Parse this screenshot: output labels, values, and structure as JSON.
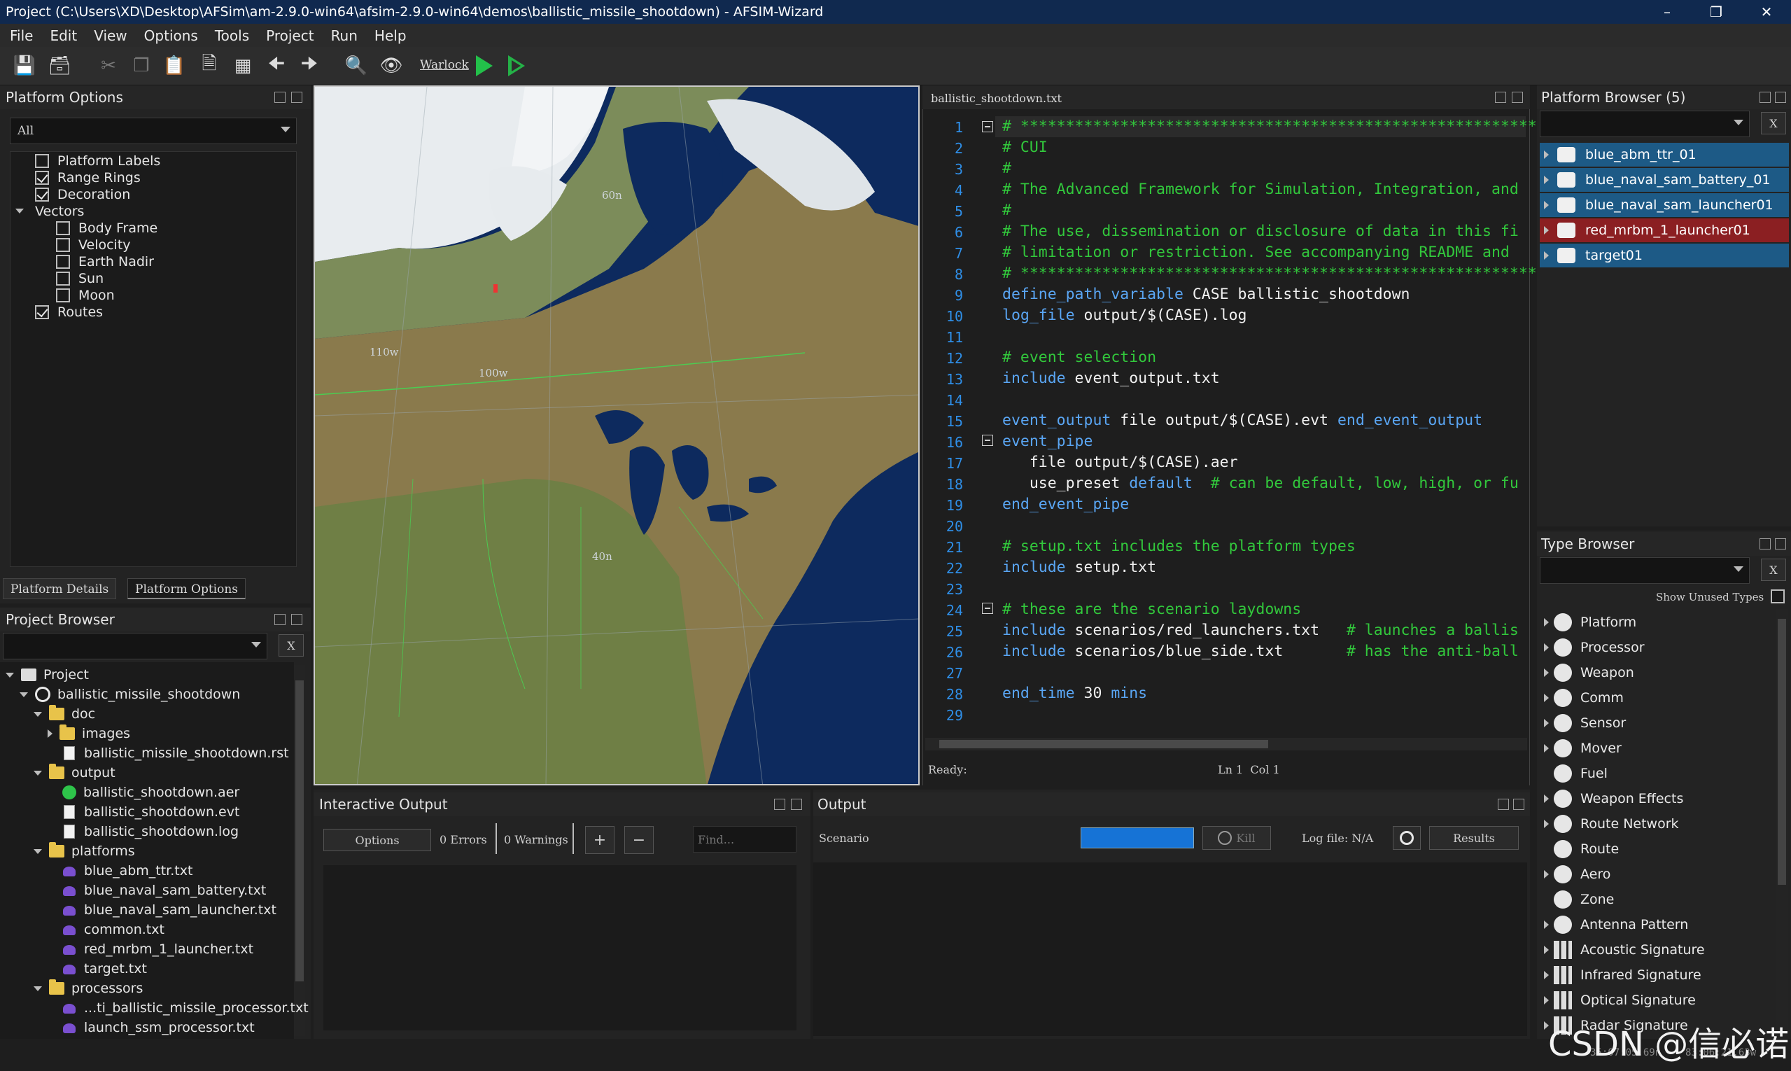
{
  "window": {
    "title": "Project (C:\\Users\\XD\\Desktop\\AFSim\\am-2.9.0-win64\\afsim-2.9.0-win64\\demos\\ballistic_missile_shootdown) - AFSIM-Wizard"
  },
  "menu": [
    "File",
    "Edit",
    "View",
    "Options",
    "Tools",
    "Project",
    "Run",
    "Help"
  ],
  "toolbar": {
    "warlock_label": "Warlock"
  },
  "platform_options": {
    "title": "Platform Options",
    "filter_value": "All",
    "items": [
      {
        "label": "Platform Labels",
        "checked": false
      },
      {
        "label": "Range Rings",
        "checked": true
      },
      {
        "label": "Decoration",
        "checked": true
      },
      {
        "label": "Vectors",
        "group": true
      },
      {
        "label": "Body Frame",
        "checked": false
      },
      {
        "label": "Velocity",
        "checked": false
      },
      {
        "label": "Earth Nadir",
        "checked": false
      },
      {
        "label": "Sun",
        "checked": false
      },
      {
        "label": "Moon",
        "checked": false
      },
      {
        "label": "Routes",
        "checked": true
      }
    ],
    "tabs": [
      "Platform Details",
      "Platform Options"
    ]
  },
  "project_browser": {
    "title": "Project Browser",
    "clear_label": "X",
    "tree": [
      "Project",
      "ballistic_missile_shootdown",
      "doc",
      "images",
      "ballistic_missile_shootdown.rst",
      "output",
      "ballistic_shootdown.aer",
      "ballistic_shootdown.evt",
      "ballistic_shootdown.log",
      "platforms",
      "blue_abm_ttr.txt",
      "blue_naval_sam_battery.txt",
      "blue_naval_sam_launcher.txt",
      "common.txt",
      "red_mrbm_1_launcher.txt",
      "target.txt",
      "processors",
      "...ti_ballistic_missile_processor.txt",
      "launch_ssm_processor.txt"
    ]
  },
  "map": {
    "labels": [
      "60n",
      "110w",
      "100w",
      "40n"
    ]
  },
  "editor": {
    "filename": "ballistic_shootdown.txt",
    "lines": [
      {
        "n": "1",
        "parts": [
          [
            "cm",
            "# ***************************************************************"
          ]
        ]
      },
      {
        "n": "2",
        "parts": [
          [
            "cm",
            "# CUI"
          ]
        ]
      },
      {
        "n": "3",
        "parts": [
          [
            "cm",
            "#"
          ]
        ]
      },
      {
        "n": "4",
        "parts": [
          [
            "cm",
            "# The Advanced Framework for Simulation, Integration, and"
          ]
        ]
      },
      {
        "n": "5",
        "parts": [
          [
            "cm",
            "#"
          ]
        ]
      },
      {
        "n": "6",
        "parts": [
          [
            "cm",
            "# The use, dissemination or disclosure of data in this fi"
          ]
        ]
      },
      {
        "n": "7",
        "parts": [
          [
            "cm",
            "# limitation or restriction. See accompanying README and"
          ]
        ]
      },
      {
        "n": "8",
        "parts": [
          [
            "cm",
            "# ***************************************************************"
          ]
        ]
      },
      {
        "n": "9",
        "parts": [
          [
            "kw",
            "define_path_variable"
          ],
          [
            "tx",
            " CASE ballistic_shootdown"
          ]
        ]
      },
      {
        "n": "10",
        "parts": [
          [
            "kw",
            "log_file"
          ],
          [
            "tx",
            " output/$(CASE).log"
          ]
        ]
      },
      {
        "n": "11",
        "parts": []
      },
      {
        "n": "12",
        "parts": [
          [
            "cm",
            "# event selection"
          ]
        ]
      },
      {
        "n": "13",
        "parts": [
          [
            "kw",
            "include"
          ],
          [
            "tx",
            " event_output.txt"
          ]
        ]
      },
      {
        "n": "14",
        "parts": []
      },
      {
        "n": "15",
        "parts": [
          [
            "kw",
            "event_output"
          ],
          [
            "tx",
            " file output/$(CASE).evt "
          ],
          [
            "kw",
            "end_event_output"
          ]
        ]
      },
      {
        "n": "16",
        "parts": [
          [
            "kw",
            "event_pipe"
          ]
        ]
      },
      {
        "n": "17",
        "parts": [
          [
            "tx",
            "   file output/$(CASE).aer"
          ]
        ]
      },
      {
        "n": "18",
        "parts": [
          [
            "tx",
            "   use_preset "
          ],
          [
            "kw",
            "default"
          ],
          [
            "cm",
            "  # can be default, low, high, or fu"
          ]
        ]
      },
      {
        "n": "19",
        "parts": [
          [
            "kw",
            "end_event_pipe"
          ]
        ]
      },
      {
        "n": "20",
        "parts": []
      },
      {
        "n": "21",
        "parts": [
          [
            "cm",
            "# setup.txt includes the platform types"
          ]
        ]
      },
      {
        "n": "22",
        "parts": [
          [
            "kw",
            "include"
          ],
          [
            "tx",
            " setup.txt"
          ]
        ]
      },
      {
        "n": "23",
        "parts": []
      },
      {
        "n": "24",
        "parts": [
          [
            "cm",
            "# these are the scenario laydowns"
          ]
        ]
      },
      {
        "n": "25",
        "parts": [
          [
            "kw",
            "include"
          ],
          [
            "tx",
            " scenarios/red_launchers.txt   "
          ],
          [
            "cm",
            "# launches a ballis"
          ]
        ]
      },
      {
        "n": "26",
        "parts": [
          [
            "kw",
            "include"
          ],
          [
            "tx",
            " scenarios/blue_side.txt       "
          ],
          [
            "cm",
            "# has the anti-ball"
          ]
        ]
      },
      {
        "n": "27",
        "parts": []
      },
      {
        "n": "28",
        "parts": [
          [
            "kw",
            "end_time"
          ],
          [
            "tx",
            " 30 "
          ],
          [
            "kw",
            "mins"
          ]
        ]
      },
      {
        "n": "29",
        "parts": []
      }
    ],
    "status": "Ready:",
    "cursor": "Ln 1  Col 1"
  },
  "platform_browser": {
    "title": "Platform Browser (5)",
    "clear_label": "X",
    "items": [
      {
        "name": "blue_abm_ttr_01",
        "color": "#1d5a86"
      },
      {
        "name": "blue_naval_sam_battery_01",
        "color": "#1d5a86"
      },
      {
        "name": "blue_naval_sam_launcher01",
        "color": "#1d5a86"
      },
      {
        "name": "red_mrbm_1_launcher01",
        "color": "#8b1f22"
      },
      {
        "name": "target01",
        "color": "#1d5a86"
      }
    ]
  },
  "type_browser": {
    "title": "Type Browser",
    "clear_label": "X",
    "show_unused_label": "Show Unused Types",
    "items": [
      "Platform",
      "Processor",
      "Weapon",
      "Comm",
      "Sensor",
      "Mover",
      "Fuel",
      "Weapon Effects",
      "Route Network",
      "Route",
      "Aero",
      "Zone",
      "Antenna Pattern",
      "Acoustic Signature",
      "Infrared Signature",
      "Optical Signature",
      "Radar Signature"
    ]
  },
  "interactive_output": {
    "title": "Interactive Output",
    "options_label": "Options",
    "errors": "0 Errors",
    "warnings": "0 Warnings",
    "plus": "+",
    "minus": "−",
    "find_placeholder": "Find..."
  },
  "output": {
    "title": "Output",
    "scenario_label": "Scenario",
    "kill_label": "Kill",
    "log_file": "Log file: N/A",
    "results_label": "Results"
  },
  "watermark": "CSDN @信必诺",
  "status_times": [
    "35:07:05.69n",
    "83:06:21.63w"
  ]
}
